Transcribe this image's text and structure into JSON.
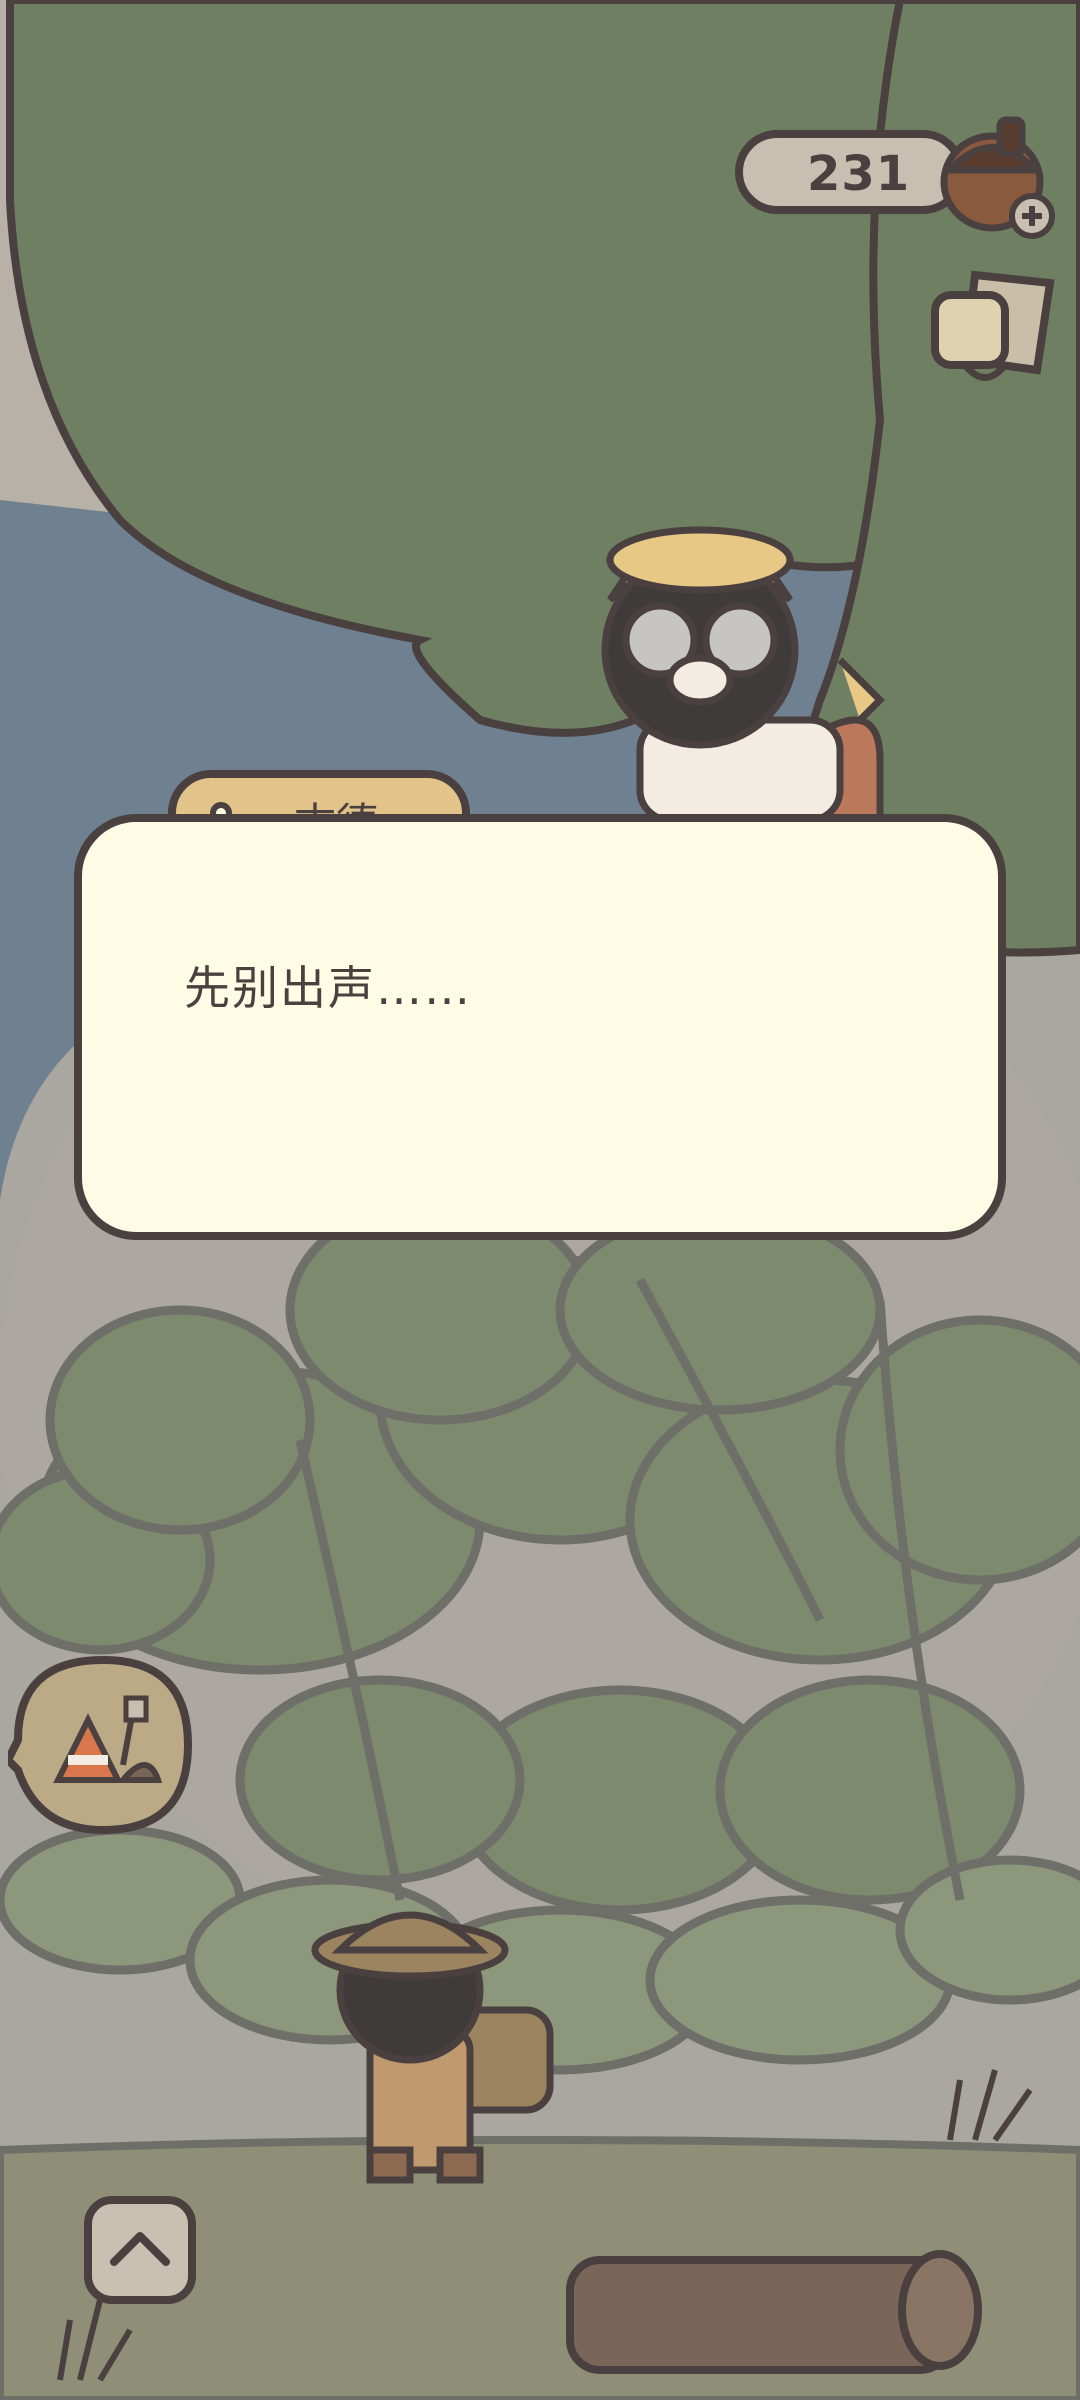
{
  "hud": {
    "acorn_count": "231",
    "currency_icon": "acorn-icon",
    "add_icon": "plus-icon",
    "shop_icon": "mug-icon"
  },
  "dialog": {
    "speaker": "古德",
    "text": "先别出声……"
  },
  "actions": {
    "dig_icon": "dig-tools-icon",
    "expand_icon": "chevron-up-icon"
  },
  "colors": {
    "outline": "#4a4040",
    "dialog_bg": "#fffce6",
    "name_tab_bg": "#e2c48a",
    "tree": "#6f7f62",
    "sky": "#6f8190"
  }
}
